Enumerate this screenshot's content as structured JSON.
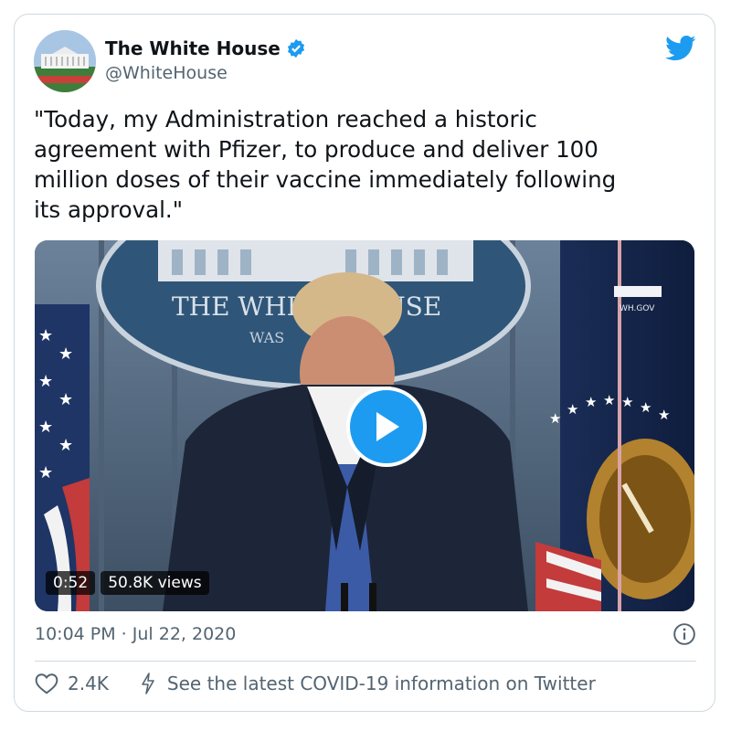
{
  "tweet": {
    "author_name": "The White House",
    "handle": "@WhiteHouse",
    "text": "\"Today, my Administration reached a historic\nagreement with Pfizer, to produce and deliver 100\nmillion doses of their vaccine immediately following\nits approval.\"",
    "timestamp": "10:04 PM · Jul 22, 2020",
    "likes": "2.4K",
    "covid_link": "See the latest COVID-19 information on Twitter"
  },
  "video": {
    "duration": "0:52",
    "views": "50.8K views",
    "seal_line1": "THE WHITE HOUSE",
    "seal_line2": "WAS",
    "watermark": "WH.GOV"
  },
  "colors": {
    "brand_blue": "#1d9bf0",
    "text_secondary": "#536471",
    "border": "#cfd9de"
  },
  "icons": [
    "verified-badge-icon",
    "twitter-bird-icon",
    "play-icon",
    "info-icon",
    "heart-icon",
    "lightning-icon"
  ]
}
